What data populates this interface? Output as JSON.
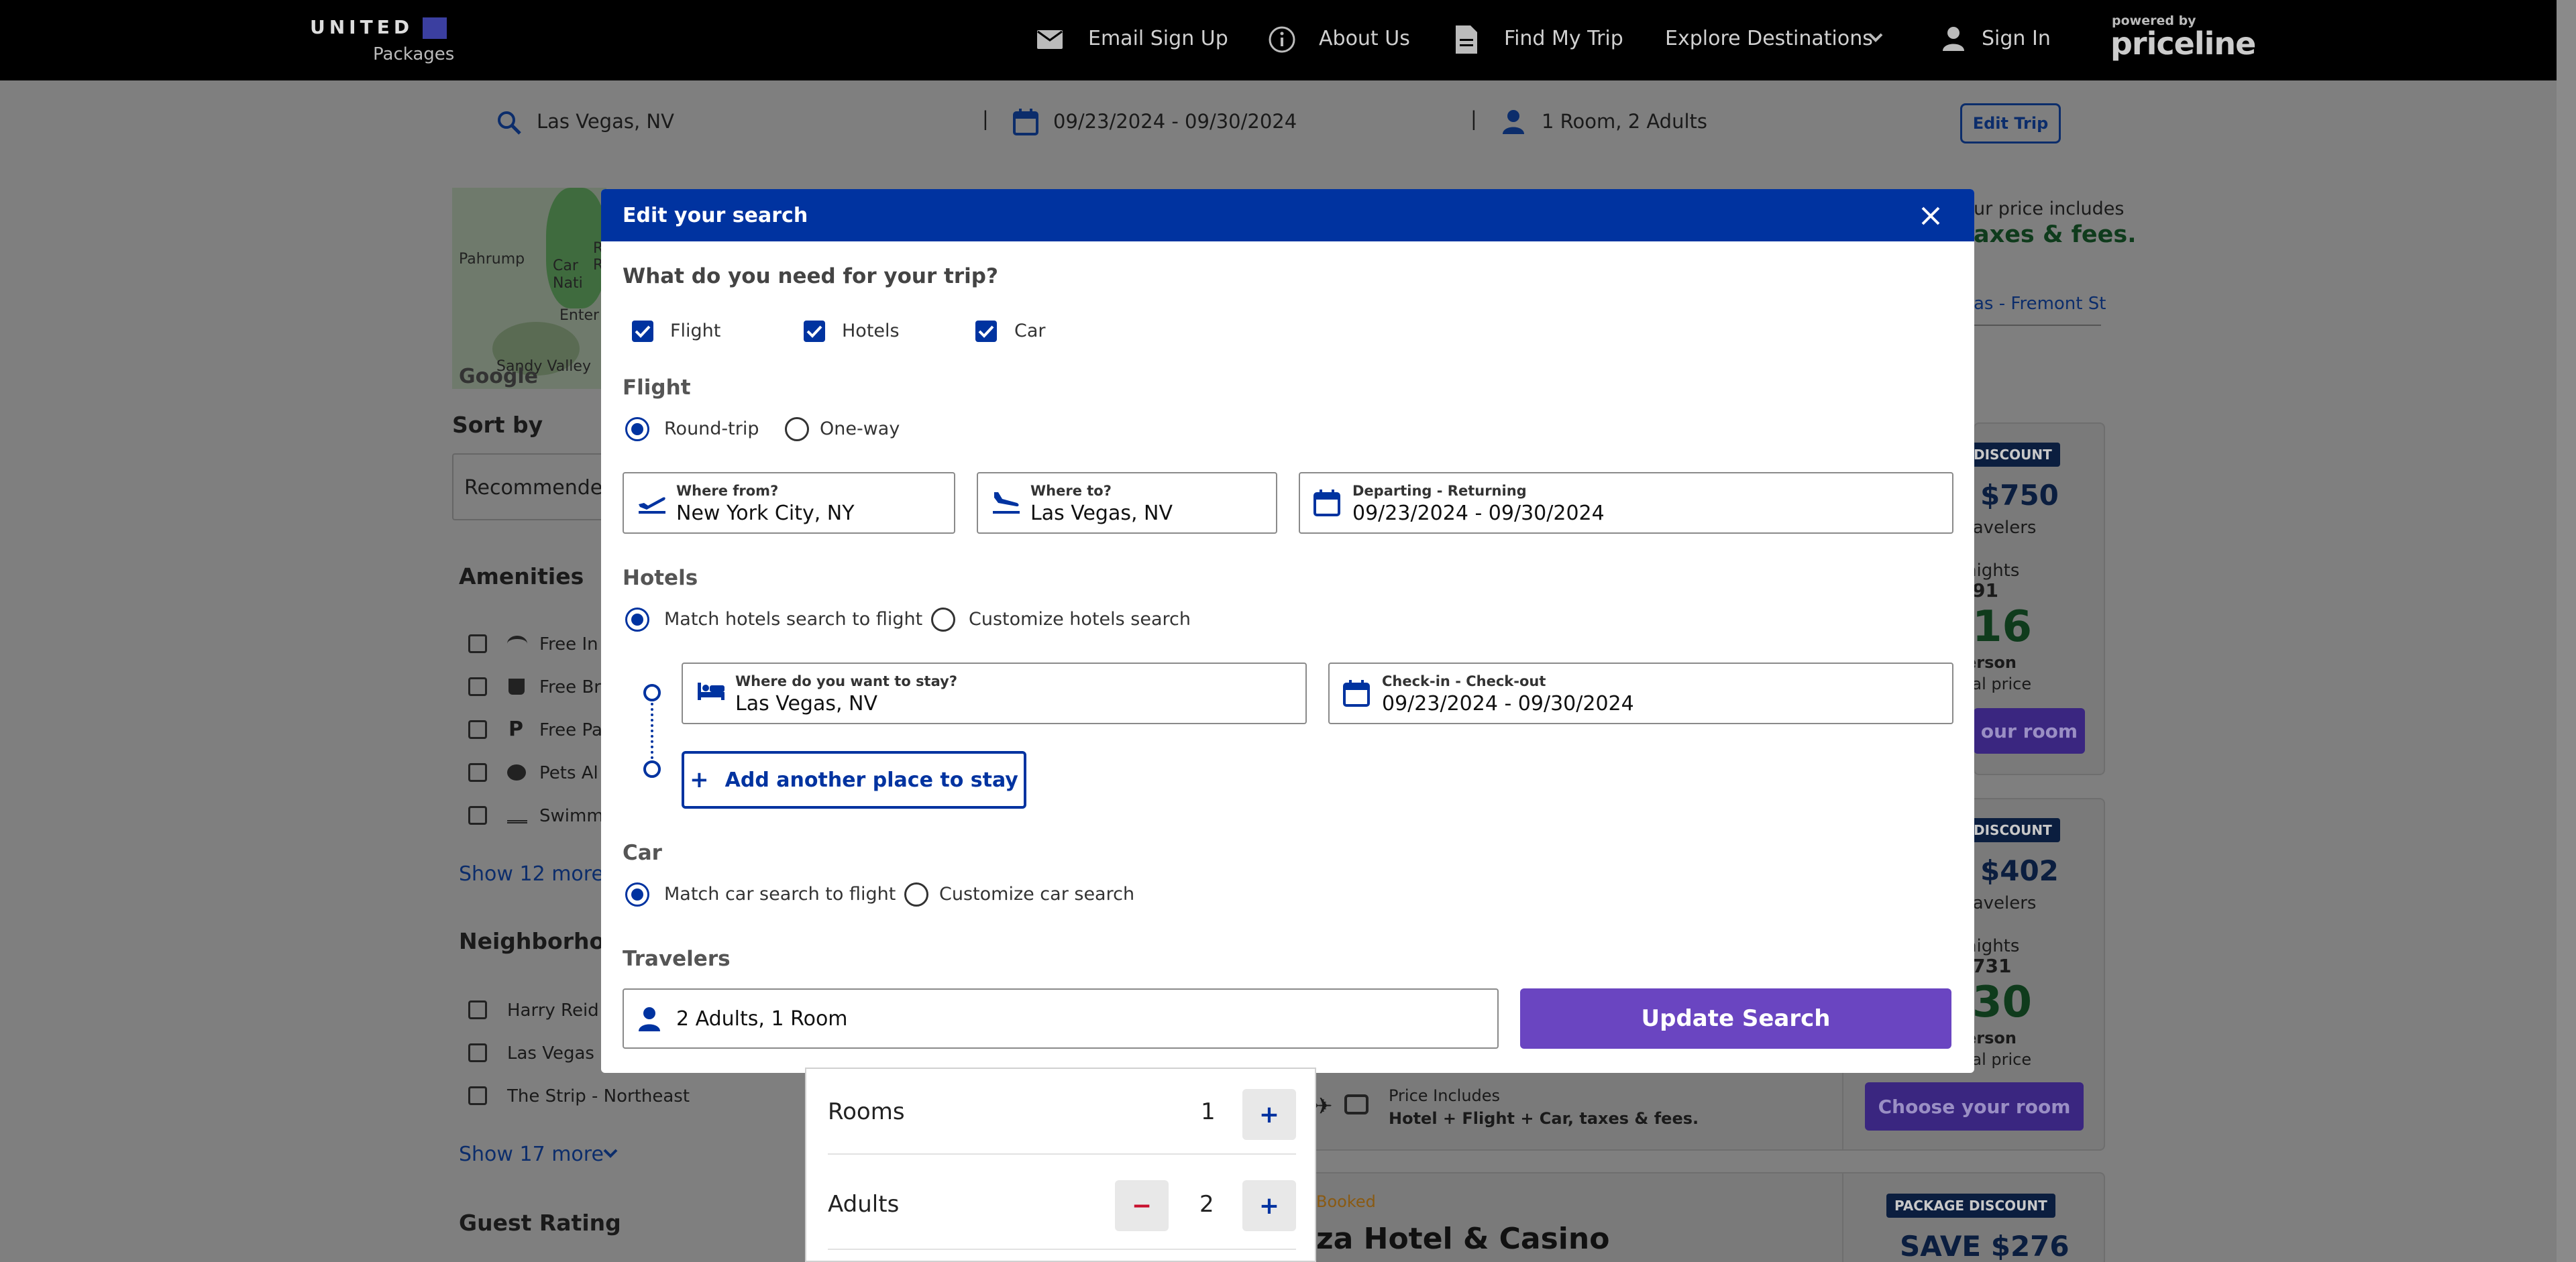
{
  "nav": {
    "brand": "UNITED",
    "brand_sub": "Packages",
    "email_signup": "Email Sign Up",
    "about_us": "About Us",
    "find_my_trip": "Find My Trip",
    "explore": "Explore Destinations",
    "sign_in": "Sign In",
    "powered_by": "powered by",
    "partner": "priceline"
  },
  "search_strip": {
    "location": "Las Vegas, NV",
    "dates": "09/23/2024 - 09/30/2024",
    "guests": "1 Room, 2 Adults",
    "edit_label": "Edit Trip",
    "divider": "|"
  },
  "background": {
    "map_labels": [
      "Pahrump",
      "Red R",
      "Car",
      "Nati",
      "Enter",
      "Sandy Valley"
    ],
    "map_logo": "Google",
    "sort_label": "Sort by",
    "sort_value": "Recommende",
    "amenities_title": "Amenities",
    "amenities": [
      "Free In",
      "Free Br",
      "Free Pa",
      "Pets Al",
      "Swimm"
    ],
    "amenities_more": "Show 12 more",
    "neighborhood_title": "Neighborhoo",
    "neighborhoods": [
      "Harry Reid",
      "Las Vegas S",
      "The Strip - Northeast"
    ],
    "neighborhoods_more": "Show 17 more",
    "guest_rating_title": "Guest Rating",
    "price_note_1": "ur price includes",
    "price_note_2": "axes & fees.",
    "link_text": "as - Fremont St",
    "cards": [
      {
        "badge": "DISCOUNT",
        "save": "$750",
        "travelers": "ravelers",
        "nights": "nights",
        "old_price": "91",
        "price": "16",
        "per": "erson",
        "total": "tal price",
        "button": "our room"
      },
      {
        "badge": "DISCOUNT",
        "save": "$402",
        "travelers": "ravelers",
        "nights": "nights",
        "old_price": "731",
        "price": "30",
        "per": "erson",
        "total": "tal price",
        "button": "Choose your room"
      },
      {
        "badge": "PACKAGE DISCOUNT",
        "save": "SAVE $276"
      }
    ],
    "price_includes": "Price Includes",
    "price_includes_detail": "Hotel + Flight + Car, taxes & fees.",
    "booked": "Booked",
    "hotel_name": "za Hotel & Casino"
  },
  "modal": {
    "title": "Edit your search",
    "question": "What do you need for your trip?",
    "products": [
      {
        "label": "Flight",
        "checked": true
      },
      {
        "label": "Hotels",
        "checked": true
      },
      {
        "label": "Car",
        "checked": true
      }
    ],
    "flight": {
      "section": "Flight",
      "trip_types": [
        {
          "label": "Round-trip",
          "selected": true
        },
        {
          "label": "One-way",
          "selected": false
        }
      ],
      "from_label": "Where from?",
      "from_value": "New York City, NY",
      "to_label": "Where to?",
      "to_value": "Las Vegas, NV",
      "dates_label": "Departing - Returning",
      "dates_value": "09/23/2024 - 09/30/2024"
    },
    "hotels": {
      "section": "Hotels",
      "options": [
        {
          "label": "Match hotels search to flight",
          "selected": true
        },
        {
          "label": "Customize hotels search",
          "selected": false
        }
      ],
      "stay_label": "Where do you want to stay?",
      "stay_value": "Las Vegas, NV",
      "check_label": "Check-in - Check-out",
      "check_value": "09/23/2024 - 09/30/2024",
      "add_place": "Add another place to stay"
    },
    "car": {
      "section": "Car",
      "options": [
        {
          "label": "Match car search to flight",
          "selected": true
        },
        {
          "label": "Customize car search",
          "selected": false
        }
      ]
    },
    "travelers": {
      "section": "Travelers",
      "value": "2 Adults, 1 Room"
    },
    "update_label": "Update Search"
  },
  "travelers_dropdown": {
    "rooms_label": "Rooms",
    "rooms_value": "1",
    "adults_label": "Adults",
    "adults_value": "2",
    "minus": "−",
    "plus": "+"
  },
  "colors": {
    "united_blue": "#0033a0",
    "update_purple": "#6a45c1",
    "nav_black": "#000000"
  }
}
